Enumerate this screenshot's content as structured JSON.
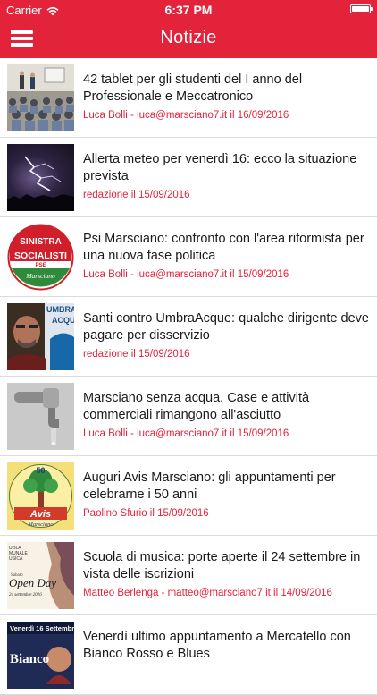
{
  "status_bar": {
    "carrier": "Carrier",
    "time": "6:37 PM"
  },
  "nav": {
    "title": "Notizie",
    "menu_icon": "hamburger-menu-icon"
  },
  "colors": {
    "brand_red": "#e3233a",
    "meta_text": "#e3233a",
    "divider": "#dcdcdc"
  },
  "news": [
    {
      "title": "42 tablet per gli studenti del I anno del Professionale e Meccatronico",
      "meta": "Luca Bolli - luca@marsciano7.it il 16/09/2016",
      "thumb": "classroom-photo"
    },
    {
      "title": "Allerta meteo per venerdì 16: ecco la situazione prevista",
      "meta": "redazione il 15/09/2016",
      "thumb": "lightning-photo"
    },
    {
      "title": "Psi Marsciano: confronto con l'area riformista per una nuova fase politica",
      "meta": "Luca Bolli - luca@marsciano7.it il 15/09/2016",
      "thumb": "socialisti-logo",
      "logo_text": {
        "line1": "SINISTRA",
        "line2": "SOCIALISTI",
        "line3": "PSE",
        "line4": "Marsciano"
      }
    },
    {
      "title": "Santi contro UmbraAcque: qualche dirigente deve pagare per disservizio",
      "meta": "redazione il 15/09/2016",
      "thumb": "man-portrait-photo",
      "logo_text": {
        "line1": "UMBRA",
        "line2": "ACQU"
      }
    },
    {
      "title": "Marsciano senza acqua. Case e attività commerciali rimangono all'asciutto",
      "meta": "Luca Bolli - luca@marsciano7.it il 15/09/2016",
      "thumb": "faucet-photo"
    },
    {
      "title": "Auguri Avis Marsciano: gli appuntamenti per celebrarne i 50 anni",
      "meta": "Paolino Sfurio il 15/09/2016",
      "thumb": "avis-logo",
      "logo_text": {
        "line1": "50",
        "line2": "Avis",
        "line3": "Marsciano"
      }
    },
    {
      "title": "Scuola di musica: porte aperte il 24 settembre in vista delle iscrizioni",
      "meta": "Matteo Berlenga - matteo@marsciano7.it il 14/09/2016",
      "thumb": "open-day-poster",
      "logo_text": {
        "line1": "UOLA",
        "line2": "MUNALE",
        "line3": "USICA",
        "line4": "Open Day",
        "line5": "Sabato",
        "line6": "24 settembre 2016"
      }
    },
    {
      "title": "Venerdì ultimo appuntamento a Mercatello con Bianco Rosso e Blues",
      "meta": "",
      "thumb": "concert-poster",
      "logo_text": {
        "line1": "Venerdì 16 Settembre",
        "line2": "Bianco"
      }
    }
  ]
}
